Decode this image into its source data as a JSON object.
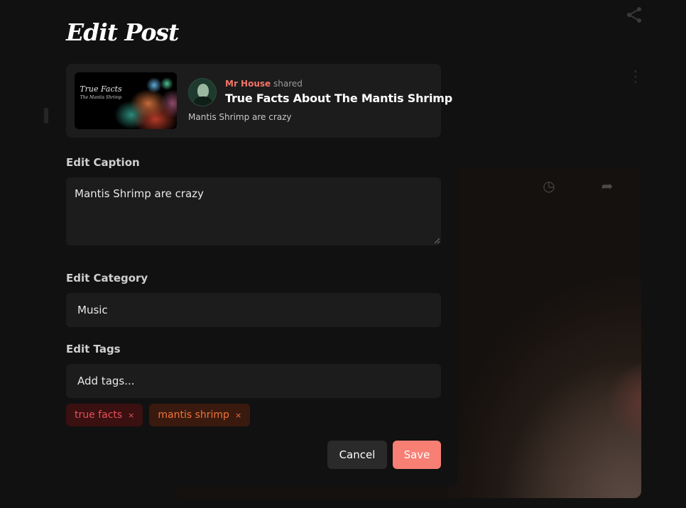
{
  "modal": {
    "title": "Edit Post",
    "preview": {
      "thumbnail_title": "True Facts",
      "thumbnail_subtitle": "The Mantis Shrimp",
      "shared_by": "Mr House",
      "shared_word": "shared",
      "post_title": "True Facts About The Mantis Shrimp",
      "post_caption": "Mantis Shrimp are crazy"
    },
    "caption": {
      "label": "Edit Caption",
      "value": "Mantis Shrimp are crazy"
    },
    "category": {
      "label": "Edit Category",
      "value": "Music"
    },
    "tags": {
      "label": "Edit Tags",
      "placeholder": "Add tags...",
      "items": [
        {
          "label": "true facts",
          "remove": "×"
        },
        {
          "label": "mantis shrimp",
          "remove": "×"
        }
      ]
    },
    "buttons": {
      "cancel": "Cancel",
      "save": "Save"
    }
  },
  "colors": {
    "accent": "#f77f74",
    "username": "#f37468",
    "tag_red": "#e9505a",
    "tag_orange": "#f0733a"
  },
  "icons": [
    "share-icon",
    "more-vertical-icon",
    "resize-grip-icon",
    "tag-remove-icon"
  ]
}
